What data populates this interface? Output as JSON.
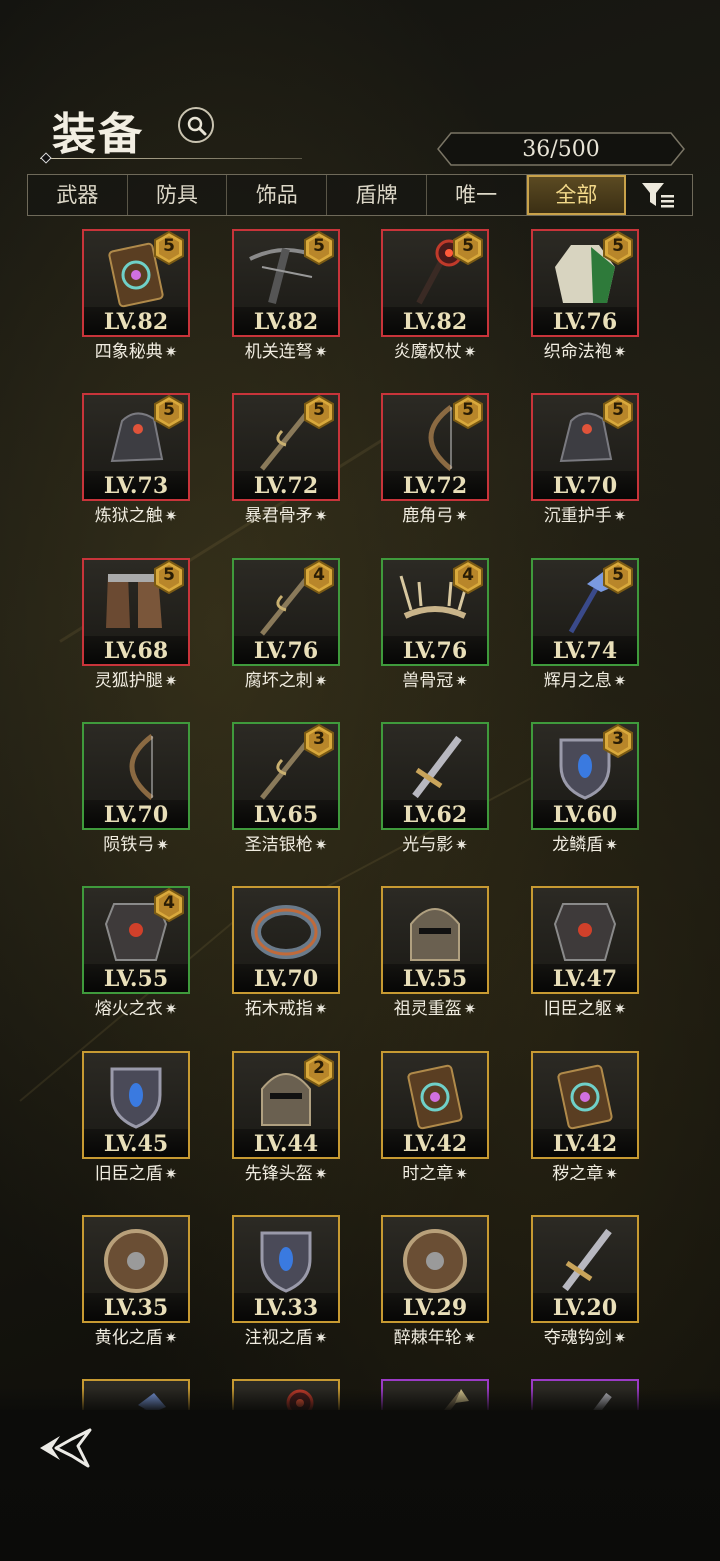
{
  "header": {
    "title": "装备",
    "capacity": "36/500"
  },
  "tabs": [
    {
      "label": "武器",
      "active": false
    },
    {
      "label": "防具",
      "active": false
    },
    {
      "label": "饰品",
      "active": false
    },
    {
      "label": "盾牌",
      "active": false
    },
    {
      "label": "唯一",
      "active": false
    },
    {
      "label": "全部",
      "active": true
    }
  ],
  "items": [
    {
      "name": "四象秘典",
      "level": "LV.82",
      "rarity": "red",
      "stars": "5",
      "art": "book"
    },
    {
      "name": "机关连弩",
      "level": "LV.82",
      "rarity": "red",
      "stars": "5",
      "art": "crossbow"
    },
    {
      "name": "炎魔权杖",
      "level": "LV.82",
      "rarity": "red",
      "stars": "5",
      "art": "scepter"
    },
    {
      "name": "织命法袍",
      "level": "LV.76",
      "rarity": "red",
      "stars": "5",
      "art": "robe"
    },
    {
      "name": "炼狱之触",
      "level": "LV.73",
      "rarity": "red",
      "stars": "5",
      "art": "gauntlet"
    },
    {
      "name": "暴君骨矛",
      "level": "LV.72",
      "rarity": "red",
      "stars": "5",
      "art": "spear"
    },
    {
      "name": "鹿角弓",
      "level": "LV.72",
      "rarity": "red",
      "stars": "5",
      "art": "bow"
    },
    {
      "name": "沉重护手",
      "level": "LV.70",
      "rarity": "red",
      "stars": "5",
      "art": "gauntlet"
    },
    {
      "name": "灵狐护腿",
      "level": "LV.68",
      "rarity": "red",
      "stars": "5",
      "art": "boots"
    },
    {
      "name": "腐坏之刺",
      "level": "LV.76",
      "rarity": "green",
      "stars": "4",
      "art": "spear"
    },
    {
      "name": "兽骨冠",
      "level": "LV.76",
      "rarity": "green",
      "stars": "4",
      "art": "crown"
    },
    {
      "name": "辉月之息",
      "level": "LV.74",
      "rarity": "green",
      "stars": "5",
      "art": "staff"
    },
    {
      "name": "陨铁弓",
      "level": "LV.70",
      "rarity": "green",
      "stars": "",
      "art": "bow"
    },
    {
      "name": "圣洁银枪",
      "level": "LV.65",
      "rarity": "green",
      "stars": "3",
      "art": "spear"
    },
    {
      "name": "光与影",
      "level": "LV.62",
      "rarity": "green",
      "stars": "",
      "art": "sword"
    },
    {
      "name": "龙鳞盾",
      "level": "LV.60",
      "rarity": "green",
      "stars": "3",
      "art": "shield"
    },
    {
      "name": "熔火之衣",
      "level": "LV.55",
      "rarity": "green",
      "stars": "4",
      "art": "armor"
    },
    {
      "name": "拓木戒指",
      "level": "LV.70",
      "rarity": "gold",
      "stars": "",
      "art": "ring"
    },
    {
      "name": "祖灵重盔",
      "level": "LV.55",
      "rarity": "gold",
      "stars": "",
      "art": "helm"
    },
    {
      "name": "旧臣之躯",
      "level": "LV.47",
      "rarity": "gold",
      "stars": "",
      "art": "armor"
    },
    {
      "name": "旧臣之盾",
      "level": "LV.45",
      "rarity": "gold",
      "stars": "",
      "art": "shield"
    },
    {
      "name": "先锋头盔",
      "level": "LV.44",
      "rarity": "gold",
      "stars": "2",
      "art": "helm"
    },
    {
      "name": "时之章",
      "level": "LV.42",
      "rarity": "gold",
      "stars": "",
      "art": "book"
    },
    {
      "name": "秽之章",
      "level": "LV.42",
      "rarity": "gold",
      "stars": "",
      "art": "book"
    },
    {
      "name": "黄化之盾",
      "level": "LV.35",
      "rarity": "gold",
      "stars": "",
      "art": "roundshield"
    },
    {
      "name": "注视之盾",
      "level": "LV.33",
      "rarity": "gold",
      "stars": "",
      "art": "shield"
    },
    {
      "name": "醉棘年轮",
      "level": "LV.29",
      "rarity": "gold",
      "stars": "",
      "art": "roundshield"
    },
    {
      "name": "夺魂钩剑",
      "level": "LV.20",
      "rarity": "gold",
      "stars": "",
      "art": "sword"
    },
    {
      "name": "",
      "level": "",
      "rarity": "gold",
      "stars": "",
      "art": "staff"
    },
    {
      "name": "",
      "level": "",
      "rarity": "gold",
      "stars": "",
      "art": "scepter"
    },
    {
      "name": "",
      "level": "",
      "rarity": "purple",
      "stars": "",
      "art": "spear"
    },
    {
      "name": "",
      "level": "",
      "rarity": "purple",
      "stars": "",
      "art": "sword"
    }
  ],
  "colors": {
    "red": "#c8343a",
    "green": "#3f9a3c",
    "gold": "#c79a32",
    "purple": "#9b3bc6",
    "active_tab": "#c9a24a"
  },
  "icons": {
    "search": "search-icon",
    "filter": "filter-sort-icon",
    "back": "back-arrow-icon",
    "star": "sparkle-star-icon",
    "badge": "hexagon-badge-icon"
  }
}
